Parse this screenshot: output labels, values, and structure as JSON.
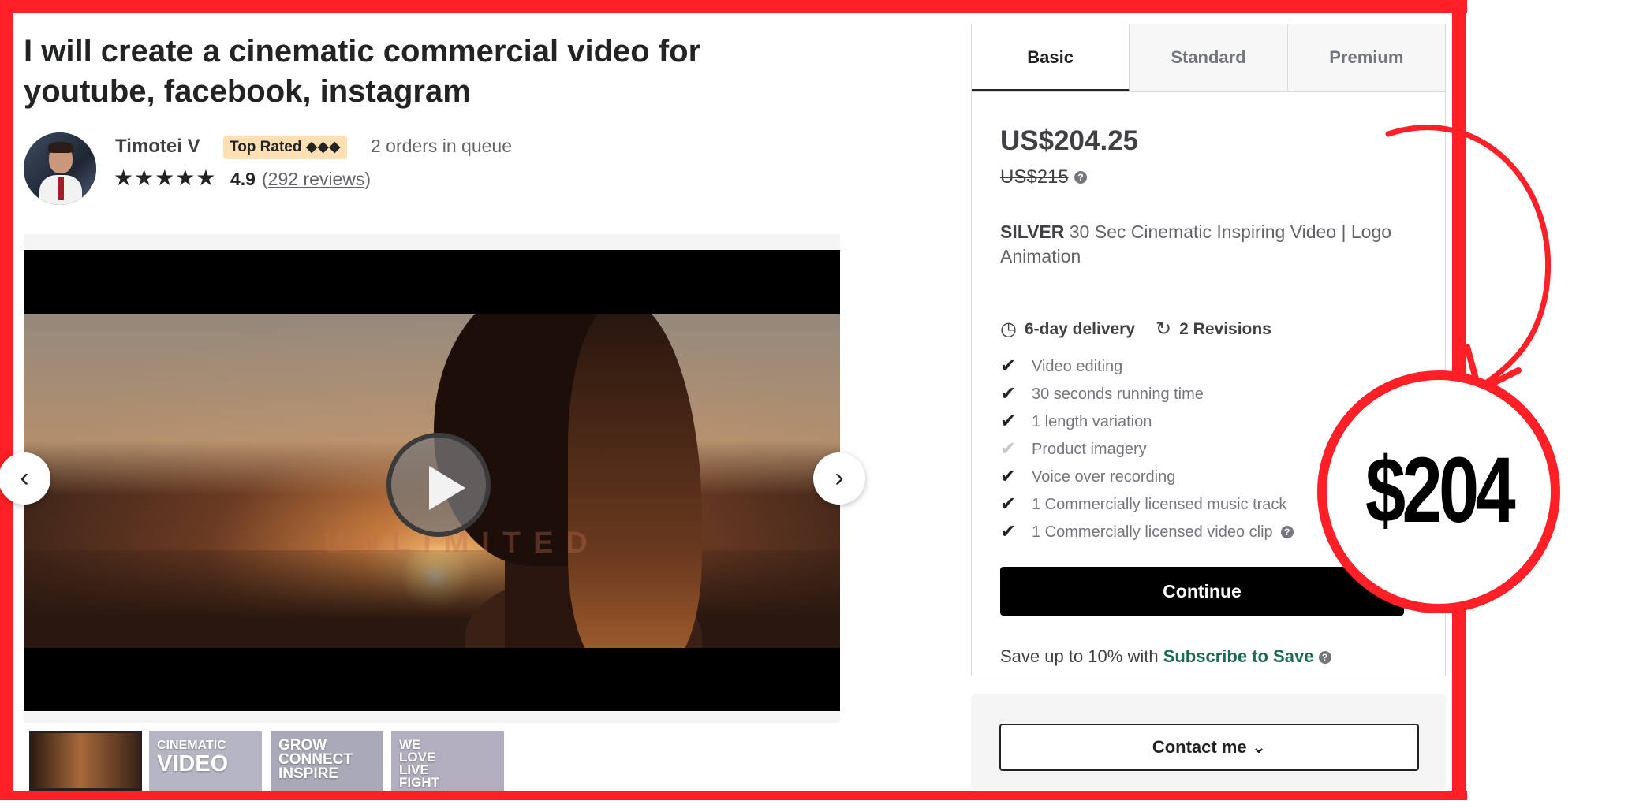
{
  "gig": {
    "title": "I will create a cinematic commercial video for youtube, facebook, instagram"
  },
  "seller": {
    "name": "Timotei V",
    "badge": "Top Rated ◆◆◆",
    "queue": "2 orders in queue",
    "stars": "★★★★★",
    "rating": "4.9",
    "reviews_open": "(",
    "reviews_link": "292 reviews",
    "reviews_close": ")"
  },
  "gallery": {
    "watermark": "UNLIMITED",
    "prev_glyph": "‹",
    "next_glyph": "›",
    "thumbnails": [
      {
        "text": ""
      },
      {
        "text_top": "CINEMATIC",
        "text_big": "VIDEO"
      },
      {
        "text": "GROW\nCONNECT\nINSPIRE"
      },
      {
        "text": "WE\nLOVE\nLIVE\nFIGHT"
      }
    ]
  },
  "package": {
    "tabs": [
      {
        "label": "Basic"
      },
      {
        "label": "Standard"
      },
      {
        "label": "Premium"
      }
    ],
    "active_tab": "Basic",
    "price": "US$204.25",
    "old_price": "US$215",
    "description_tier": "SILVER",
    "description_rest": " 30 Sec Cinematic Inspiring Video | Logo Animation",
    "delivery": "6-day delivery",
    "revisions": "2 Revisions",
    "features": [
      {
        "label": "Video editing",
        "included": true
      },
      {
        "label": "30 seconds running time",
        "included": true
      },
      {
        "label": "1 length variation",
        "included": true
      },
      {
        "label": "Product imagery",
        "included": false
      },
      {
        "label": "Voice over recording",
        "included": true
      },
      {
        "label": "1 Commercially licensed music track",
        "included": true
      },
      {
        "label": "1 Commercially licensed video clip",
        "included": true
      }
    ],
    "continue_label": "Continue",
    "save_prefix": "Save up to 10% with ",
    "save_link": "Subscribe to Save",
    "contact_label": "Contact me ⌄"
  },
  "annotation": {
    "circle_price": "$204"
  },
  "colors": {
    "frame": "#ff1f26",
    "badge": "#ffe0b3",
    "link_green": "#1b6b52"
  }
}
